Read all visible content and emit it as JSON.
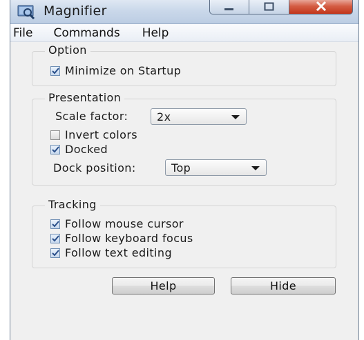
{
  "window": {
    "title": "Magnifier",
    "icon": "magnifier-app-icon"
  },
  "caption_buttons": [
    "minimize-icon",
    "maximize-icon",
    "close-icon"
  ],
  "menu": [
    "File",
    "Commands",
    "Help"
  ],
  "option_group": {
    "legend": "Option",
    "minimize_on_startup": {
      "label": "Minimize on Startup",
      "checked": true
    }
  },
  "presentation_group": {
    "legend": "Presentation",
    "scale_label": "Scale factor:",
    "scale_value": "2x",
    "invert_colors": {
      "label": "Invert colors",
      "checked": false
    },
    "docked": {
      "label": "Docked",
      "checked": true
    },
    "dock_label": "Dock position:",
    "dock_value": "Top"
  },
  "tracking_group": {
    "legend": "Tracking",
    "follow_mouse": {
      "label": "Follow mouse cursor",
      "checked": true
    },
    "follow_keyboard": {
      "label": "Follow keyboard focus",
      "checked": true
    },
    "follow_text": {
      "label": "Follow text editing",
      "checked": true
    }
  },
  "buttons": {
    "help": "Help",
    "hide": "Hide"
  },
  "colors": {
    "title_bar": "#cad8ea",
    "close_button": "#c2351b",
    "dialog_background": "#f0f0f0",
    "checkmark": "#2a4f8a"
  }
}
